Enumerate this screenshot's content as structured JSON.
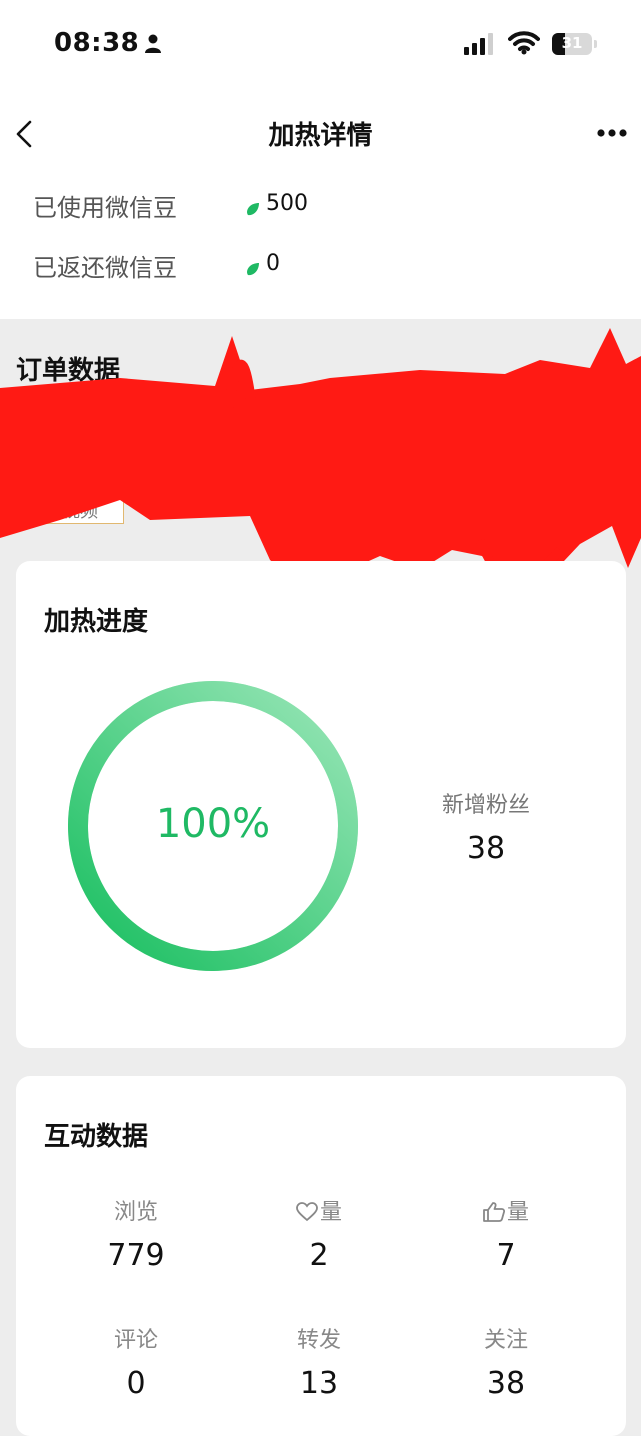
{
  "status_bar": {
    "time": "08:38",
    "battery": "31"
  },
  "nav": {
    "title": "加热详情"
  },
  "beans": [
    {
      "label": "已使用微信豆",
      "value": "500"
    },
    {
      "label": "已返还微信豆",
      "value": "0"
    }
  ],
  "order": {
    "title": "订单数据",
    "chip_label": "全部视频"
  },
  "progress": {
    "title": "加热进度",
    "percent_text": "100%",
    "percent": 100,
    "fans_label": "新增粉丝",
    "fans_value": "38"
  },
  "interaction": {
    "title": "互动数据",
    "stats": [
      {
        "label": "浏览",
        "value": "779"
      },
      {
        "label": "量",
        "value": "2",
        "icon": "heart-icon"
      },
      {
        "label": "量",
        "value": "7",
        "icon": "thumbs-up-icon"
      },
      {
        "label": "评论",
        "value": "0"
      },
      {
        "label": "转发",
        "value": "13"
      },
      {
        "label": "关注",
        "value": "38"
      }
    ]
  },
  "colors": {
    "accent": "#1fb964",
    "ring_light": "#b6ecc9",
    "redaction": "#ff1a14"
  }
}
